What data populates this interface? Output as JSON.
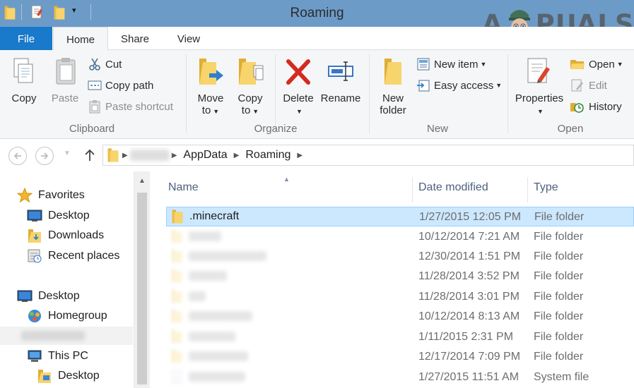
{
  "window": {
    "title": "Roaming",
    "watermark_left": "A",
    "watermark_right": "PUALS"
  },
  "tabs": [
    {
      "label": "File"
    },
    {
      "label": "Home"
    },
    {
      "label": "Share"
    },
    {
      "label": "View"
    }
  ],
  "ribbon": {
    "clipboard": {
      "copy": "Copy",
      "paste": "Paste",
      "cut": "Cut",
      "copy_path": "Copy path",
      "paste_shortcut": "Paste shortcut",
      "label": "Clipboard"
    },
    "organize": {
      "move_to_1": "Move",
      "move_to_2": "to",
      "copy_to_1": "Copy",
      "copy_to_2": "to",
      "delete": "Delete",
      "rename": "Rename",
      "label": "Organize"
    },
    "new": {
      "new_folder_1": "New",
      "new_folder_2": "folder",
      "new_item": "New item",
      "easy_access": "Easy access",
      "label": "New"
    },
    "open": {
      "properties": "Properties",
      "open": "Open",
      "edit": "Edit",
      "history": "History",
      "label": "Open"
    }
  },
  "address": {
    "crumbs": [
      "AppData",
      "Roaming"
    ]
  },
  "nav": {
    "favorites": "Favorites",
    "desktop": "Desktop",
    "downloads": "Downloads",
    "recent_places": "Recent places",
    "desktop2": "Desktop",
    "homegroup": "Homegroup",
    "this_pc": "This PC",
    "pc_desktop": "Desktop"
  },
  "columns": {
    "name": "Name",
    "date_modified": "Date modified",
    "type": "Type"
  },
  "files": [
    {
      "name": ".minecraft",
      "date": "1/27/2015 12:05 PM",
      "type": "File folder"
    },
    {
      "name": "",
      "date": "10/12/2014 7:21 AM",
      "type": "File folder"
    },
    {
      "name": "",
      "date": "12/30/2014 1:51 PM",
      "type": "File folder"
    },
    {
      "name": "",
      "date": "11/28/2014 3:52 PM",
      "type": "File folder"
    },
    {
      "name": "",
      "date": "11/28/2014 3:01 PM",
      "type": "File folder"
    },
    {
      "name": "",
      "date": "10/12/2014 8:13 AM",
      "type": "File folder"
    },
    {
      "name": "",
      "date": "1/11/2015 2:31 PM",
      "type": "File folder"
    },
    {
      "name": "",
      "date": "12/17/2014 7:09 PM",
      "type": "File folder"
    },
    {
      "name": "",
      "date": "1/27/2015 11:51 AM",
      "type": "System file"
    }
  ],
  "colors": {
    "titlebar": "#6d9bc8",
    "file_tab": "#1979ca",
    "selection": "#cce8ff",
    "selection_border": "#99d1ff",
    "folder": "#f4cf5a"
  }
}
